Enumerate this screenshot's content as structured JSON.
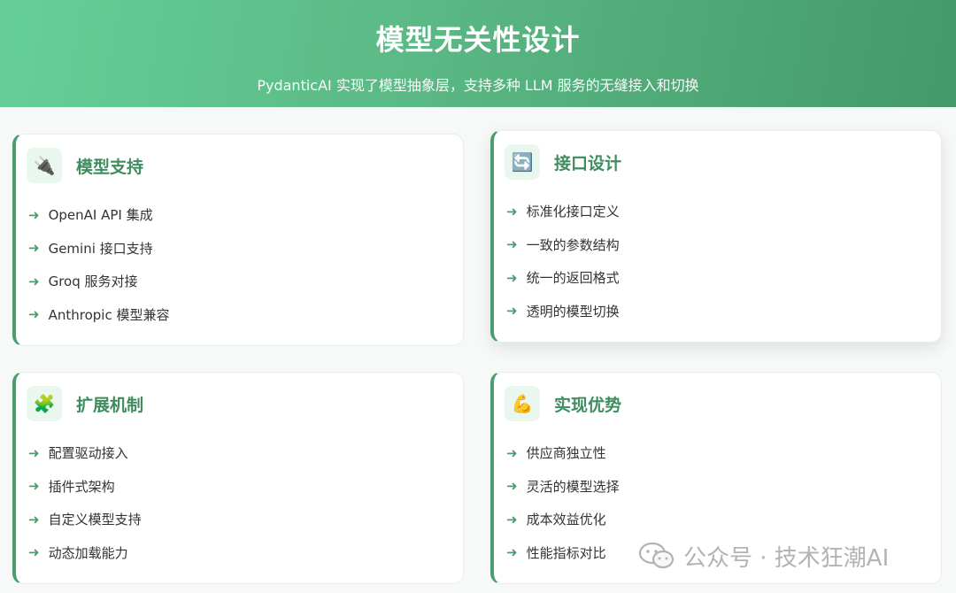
{
  "header": {
    "title": "模型无关性设计",
    "subtitle": "PydanticAI 实现了模型抽象层，支持多种 LLM 服务的无缝接入和切换"
  },
  "cards": [
    {
      "icon": "plug-icon",
      "icon_glyph": "🔌",
      "title": "模型支持",
      "items": [
        "OpenAI API 集成",
        "Gemini 接口支持",
        "Groq 服务对接",
        "Anthropic 模型兼容"
      ]
    },
    {
      "icon": "refresh-icon",
      "icon_glyph": "🔄",
      "title": "接口设计",
      "items": [
        "标准化接口定义",
        "一致的参数结构",
        "统一的返回格式",
        "透明的模型切换"
      ]
    },
    {
      "icon": "puzzle-icon",
      "icon_glyph": "🧩",
      "title": "扩展机制",
      "items": [
        "配置驱动接入",
        "插件式架构",
        "自定义模型支持",
        "动态加载能力"
      ]
    },
    {
      "icon": "flexed-biceps-icon",
      "icon_glyph": "💪",
      "title": "实现优势",
      "items": [
        "供应商独立性",
        "灵活的模型选择",
        "成本效益优化",
        "性能指标对比"
      ]
    }
  ],
  "bullet": "➜",
  "watermark": {
    "icon": "wechat-icon",
    "text": "公众号 · 技术狂潮AI"
  },
  "colors": {
    "header_start": "#66cf97",
    "header_end": "#43996a",
    "accent": "#4a9d6e",
    "title": "#3f8d5f"
  }
}
